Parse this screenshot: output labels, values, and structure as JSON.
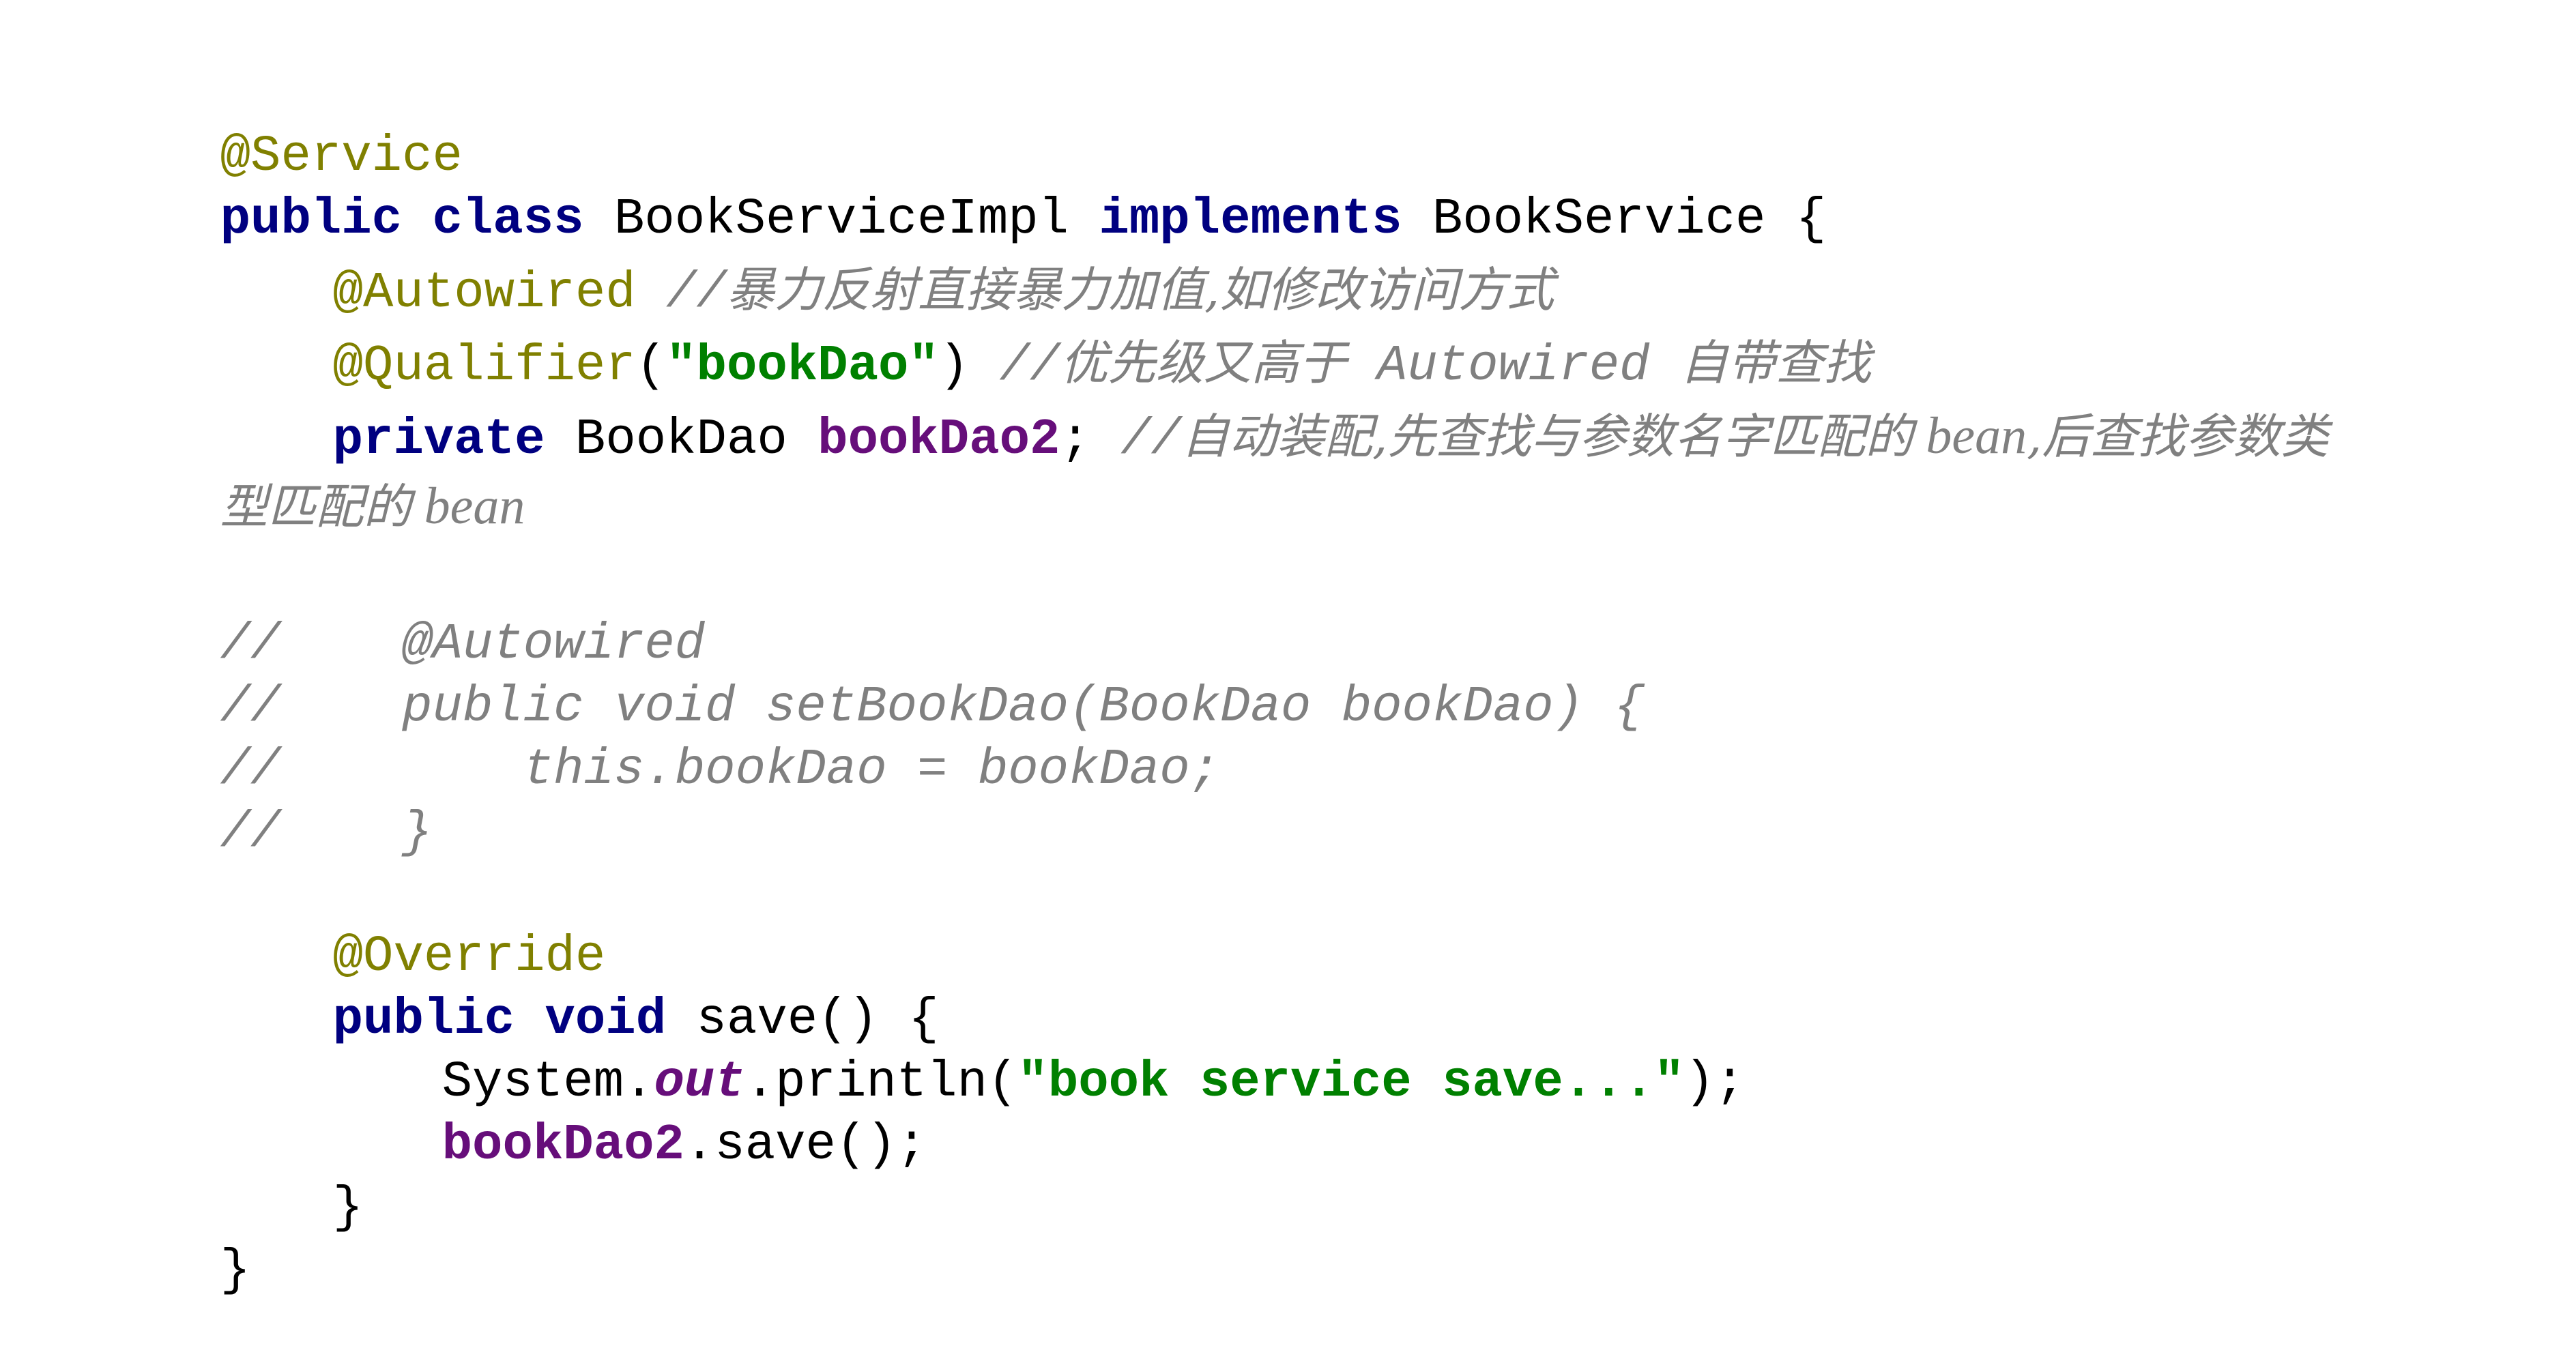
{
  "editor": {
    "code": {
      "l1": {
        "annotation": "@Service"
      },
      "l2": {
        "kw": "public class ",
        "name": "BookServiceImpl ",
        "kw2": "implements ",
        "iface": "BookService {"
      },
      "l3": {
        "annotation": "@Autowired ",
        "comment_prefix": "//",
        "comment_text": "暴力反射直接暴力加值,如修改访问方式"
      },
      "l4": {
        "annotation": "@Qualifier",
        "paren_open": "(",
        "string": "\"bookDao\"",
        "paren_close": ") ",
        "comment_prefix": "//",
        "comment_text": "优先级又高于",
        "comment_word": " Autowired ",
        "comment_text2": "自带查找"
      },
      "l5": {
        "kw": "private ",
        "type": "BookDao ",
        "field": "bookDao2",
        "semi": "; ",
        "comment_prefix": "//",
        "comment_text": "自动装配,先查找与参数名字匹配的",
        "comment_word": " bean",
        "comment_text2": ",后查找参数类"
      },
      "l6": {
        "comment_text": "型匹配的",
        "comment_word": " bean"
      },
      "l8": {
        "comment": "//    @Autowired"
      },
      "l9": {
        "comment": "//    public void setBookDao(BookDao bookDao) {"
      },
      "l10": {
        "comment": "//        this.bookDao = bookDao;"
      },
      "l11": {
        "comment": "//    }"
      },
      "l13": {
        "annotation": "@Override"
      },
      "l14": {
        "kw": "public void ",
        "rest": "save() {"
      },
      "l15": {
        "system": "System.",
        "out": "out",
        "println": ".println(",
        "string": "\"book service save...\"",
        "close": ");"
      },
      "l16": {
        "field": "bookDao2",
        "rest": ".save();"
      },
      "l17": {
        "brace": "}"
      },
      "l18": {
        "brace": "}"
      }
    }
  }
}
